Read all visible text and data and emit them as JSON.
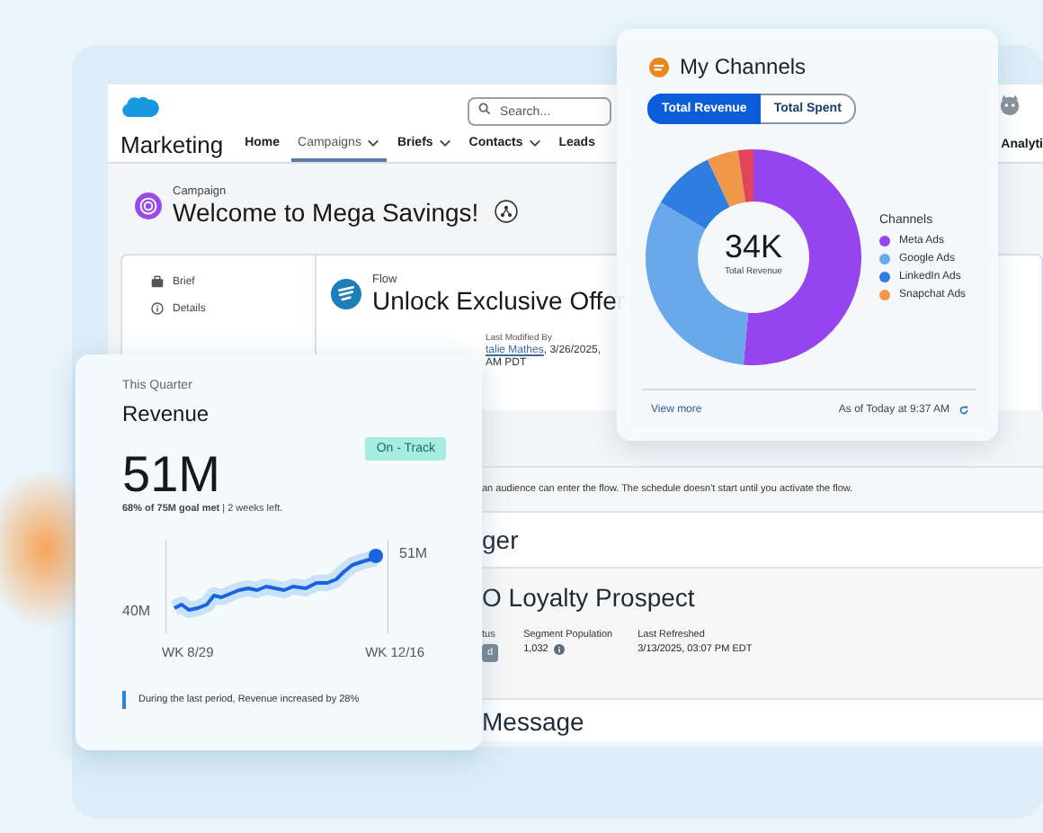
{
  "app": {
    "search": {
      "placeholder": "Search..."
    },
    "app_name": "Marketing",
    "nav_tabs": [
      {
        "label": "Home",
        "selected": false,
        "dropdown": false
      },
      {
        "label": "Campaigns",
        "selected": true,
        "dropdown": true
      },
      {
        "label": "Briefs",
        "selected": false,
        "dropdown": true
      },
      {
        "label": "Contacts",
        "selected": false,
        "dropdown": true
      },
      {
        "label": "Leads",
        "selected": false,
        "dropdown": false
      }
    ],
    "nav_overflow": "Analyti",
    "campaign": {
      "type_label": "Campaign",
      "title": "Welcome to Mega Savings!"
    },
    "sidebar": {
      "items": [
        {
          "label": "Brief",
          "kind": "brief"
        },
        {
          "label": "Details",
          "kind": "details"
        }
      ]
    },
    "flow": {
      "type_label": "Flow",
      "title": "Unlock Exclusive Offer",
      "field_label": "Last Modified By",
      "field_link": "talie Mathes",
      "field_text": ", 3/26/2025,",
      "field_line2": "AM PDT"
    },
    "description": "an audience can enter the flow. The schedule doesn't start until you activate the flow.",
    "trigger_heading": "ger",
    "segment": {
      "title": "O Loyalty Prospect",
      "fields": [
        {
          "label": "tus",
          "value": "d",
          "kind": "badge"
        },
        {
          "label": "Segment Population",
          "value": "1,032",
          "kind": "info"
        },
        {
          "label": "Last Refreshed",
          "value": "3/13/2025, 03:07 PM EDT",
          "kind": "text"
        }
      ]
    },
    "message_heading": "Message"
  },
  "channels_card": {
    "title": "My Channels",
    "toggle": [
      {
        "label": "Total Revenue",
        "selected": true
      },
      {
        "label": "Total Spent",
        "selected": false
      }
    ],
    "center_value": "34K",
    "center_label": "Total Revenue",
    "legend_title": "Channels",
    "legend": [
      {
        "label": "Meta Ads",
        "color": "#9645ee"
      },
      {
        "label": "Google Ads",
        "color": "#6aa8ec"
      },
      {
        "label": "LinkedIn Ads",
        "color": "#2f7de0"
      },
      {
        "label": "Snapchat Ads",
        "color": "#f0974a"
      }
    ],
    "link": "View more",
    "timestamp": "As of Today at 9:37 AM"
  },
  "revenue_card": {
    "period": "This Quarter",
    "title": "Revenue",
    "status": "On - Track",
    "value": "51M",
    "goal": "**68% of 75M goal met** | 2 weeks left.",
    "y_top": "51M",
    "y_bottom": "40M",
    "x_labels": [
      "WK 8/29",
      "WK 12/16"
    ],
    "insight": "During the last period, Revenue increased by 28%"
  }
}
